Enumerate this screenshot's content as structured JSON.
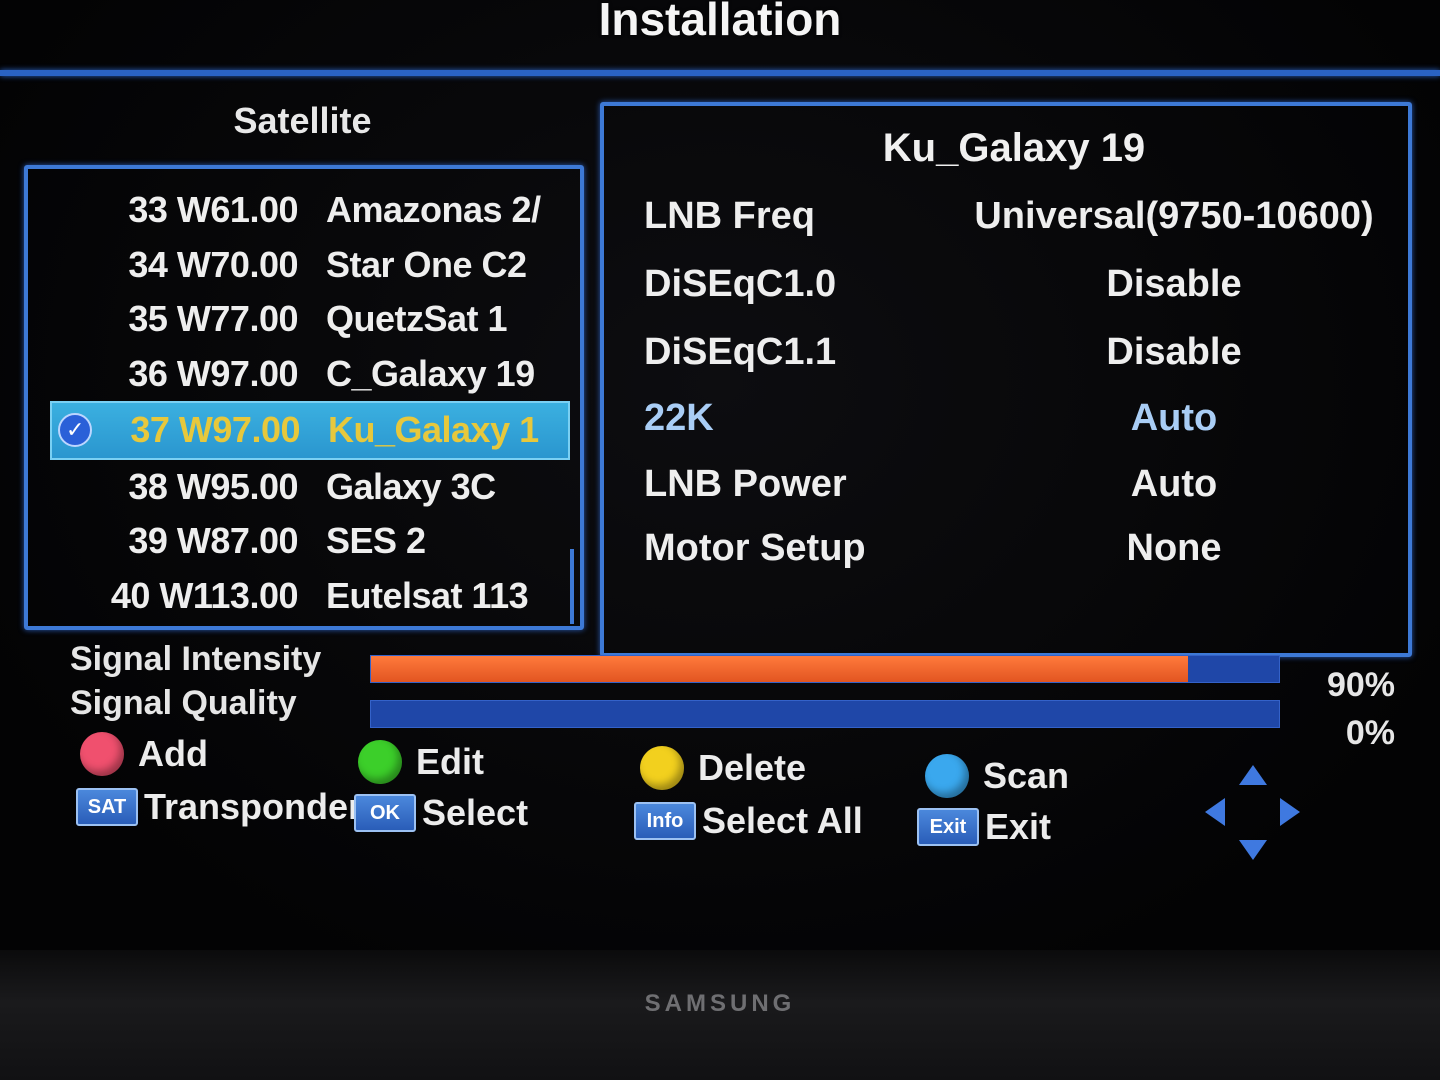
{
  "header": {
    "title": "Installation"
  },
  "satellite_panel": {
    "heading": "Satellite",
    "rows": [
      {
        "num": "33 W61.00",
        "name": "Amazonas 2/"
      },
      {
        "num": "34 W70.00",
        "name": "Star One C2"
      },
      {
        "num": "35 W77.00",
        "name": "QuetzSat 1"
      },
      {
        "num": "36 W97.00",
        "name": "C_Galaxy 19"
      },
      {
        "num": "37 W97.00",
        "name": "Ku_Galaxy 1",
        "selected": true
      },
      {
        "num": "38 W95.00",
        "name": "Galaxy 3C"
      },
      {
        "num": "39 W87.00",
        "name": "SES 2"
      },
      {
        "num": "40 W113.00",
        "name": "Eutelsat 113"
      }
    ],
    "selected_mark": "✓"
  },
  "details": {
    "title": "Ku_Galaxy 19",
    "params": [
      {
        "label": "LNB Freq",
        "value": "Universal(9750-10600)"
      },
      {
        "label": "DiSEqC1.0",
        "value": "Disable"
      },
      {
        "label": "DiSEqC1.1",
        "value": "Disable"
      },
      {
        "label": "22K",
        "value": "Auto",
        "highlight": true
      },
      {
        "label": "LNB Power",
        "value": "Auto"
      },
      {
        "label": "Motor Setup",
        "value": "None"
      }
    ]
  },
  "signal": {
    "intensity_label": "Signal Intensity",
    "intensity_value": 90,
    "intensity_text": "90%",
    "quality_label": "Signal Quality",
    "quality_value": 0,
    "quality_text": "0%"
  },
  "legend": {
    "add": "Add",
    "edit": "Edit",
    "delete": "Delete",
    "scan": "Scan",
    "sat_key": "SAT",
    "transponder": "Transponder",
    "ok_key": "OK",
    "select": "Select",
    "info_key": "Info",
    "select_all": "Select All",
    "exit_key": "Exit",
    "exit": "Exit"
  },
  "colors": {
    "red": "#f0506e",
    "green": "#3ccf2a",
    "yellow": "#f2d01e",
    "blue": "#3aa8ee",
    "accent": "#3d79d6"
  },
  "tv_brand": "SAMSUNG"
}
